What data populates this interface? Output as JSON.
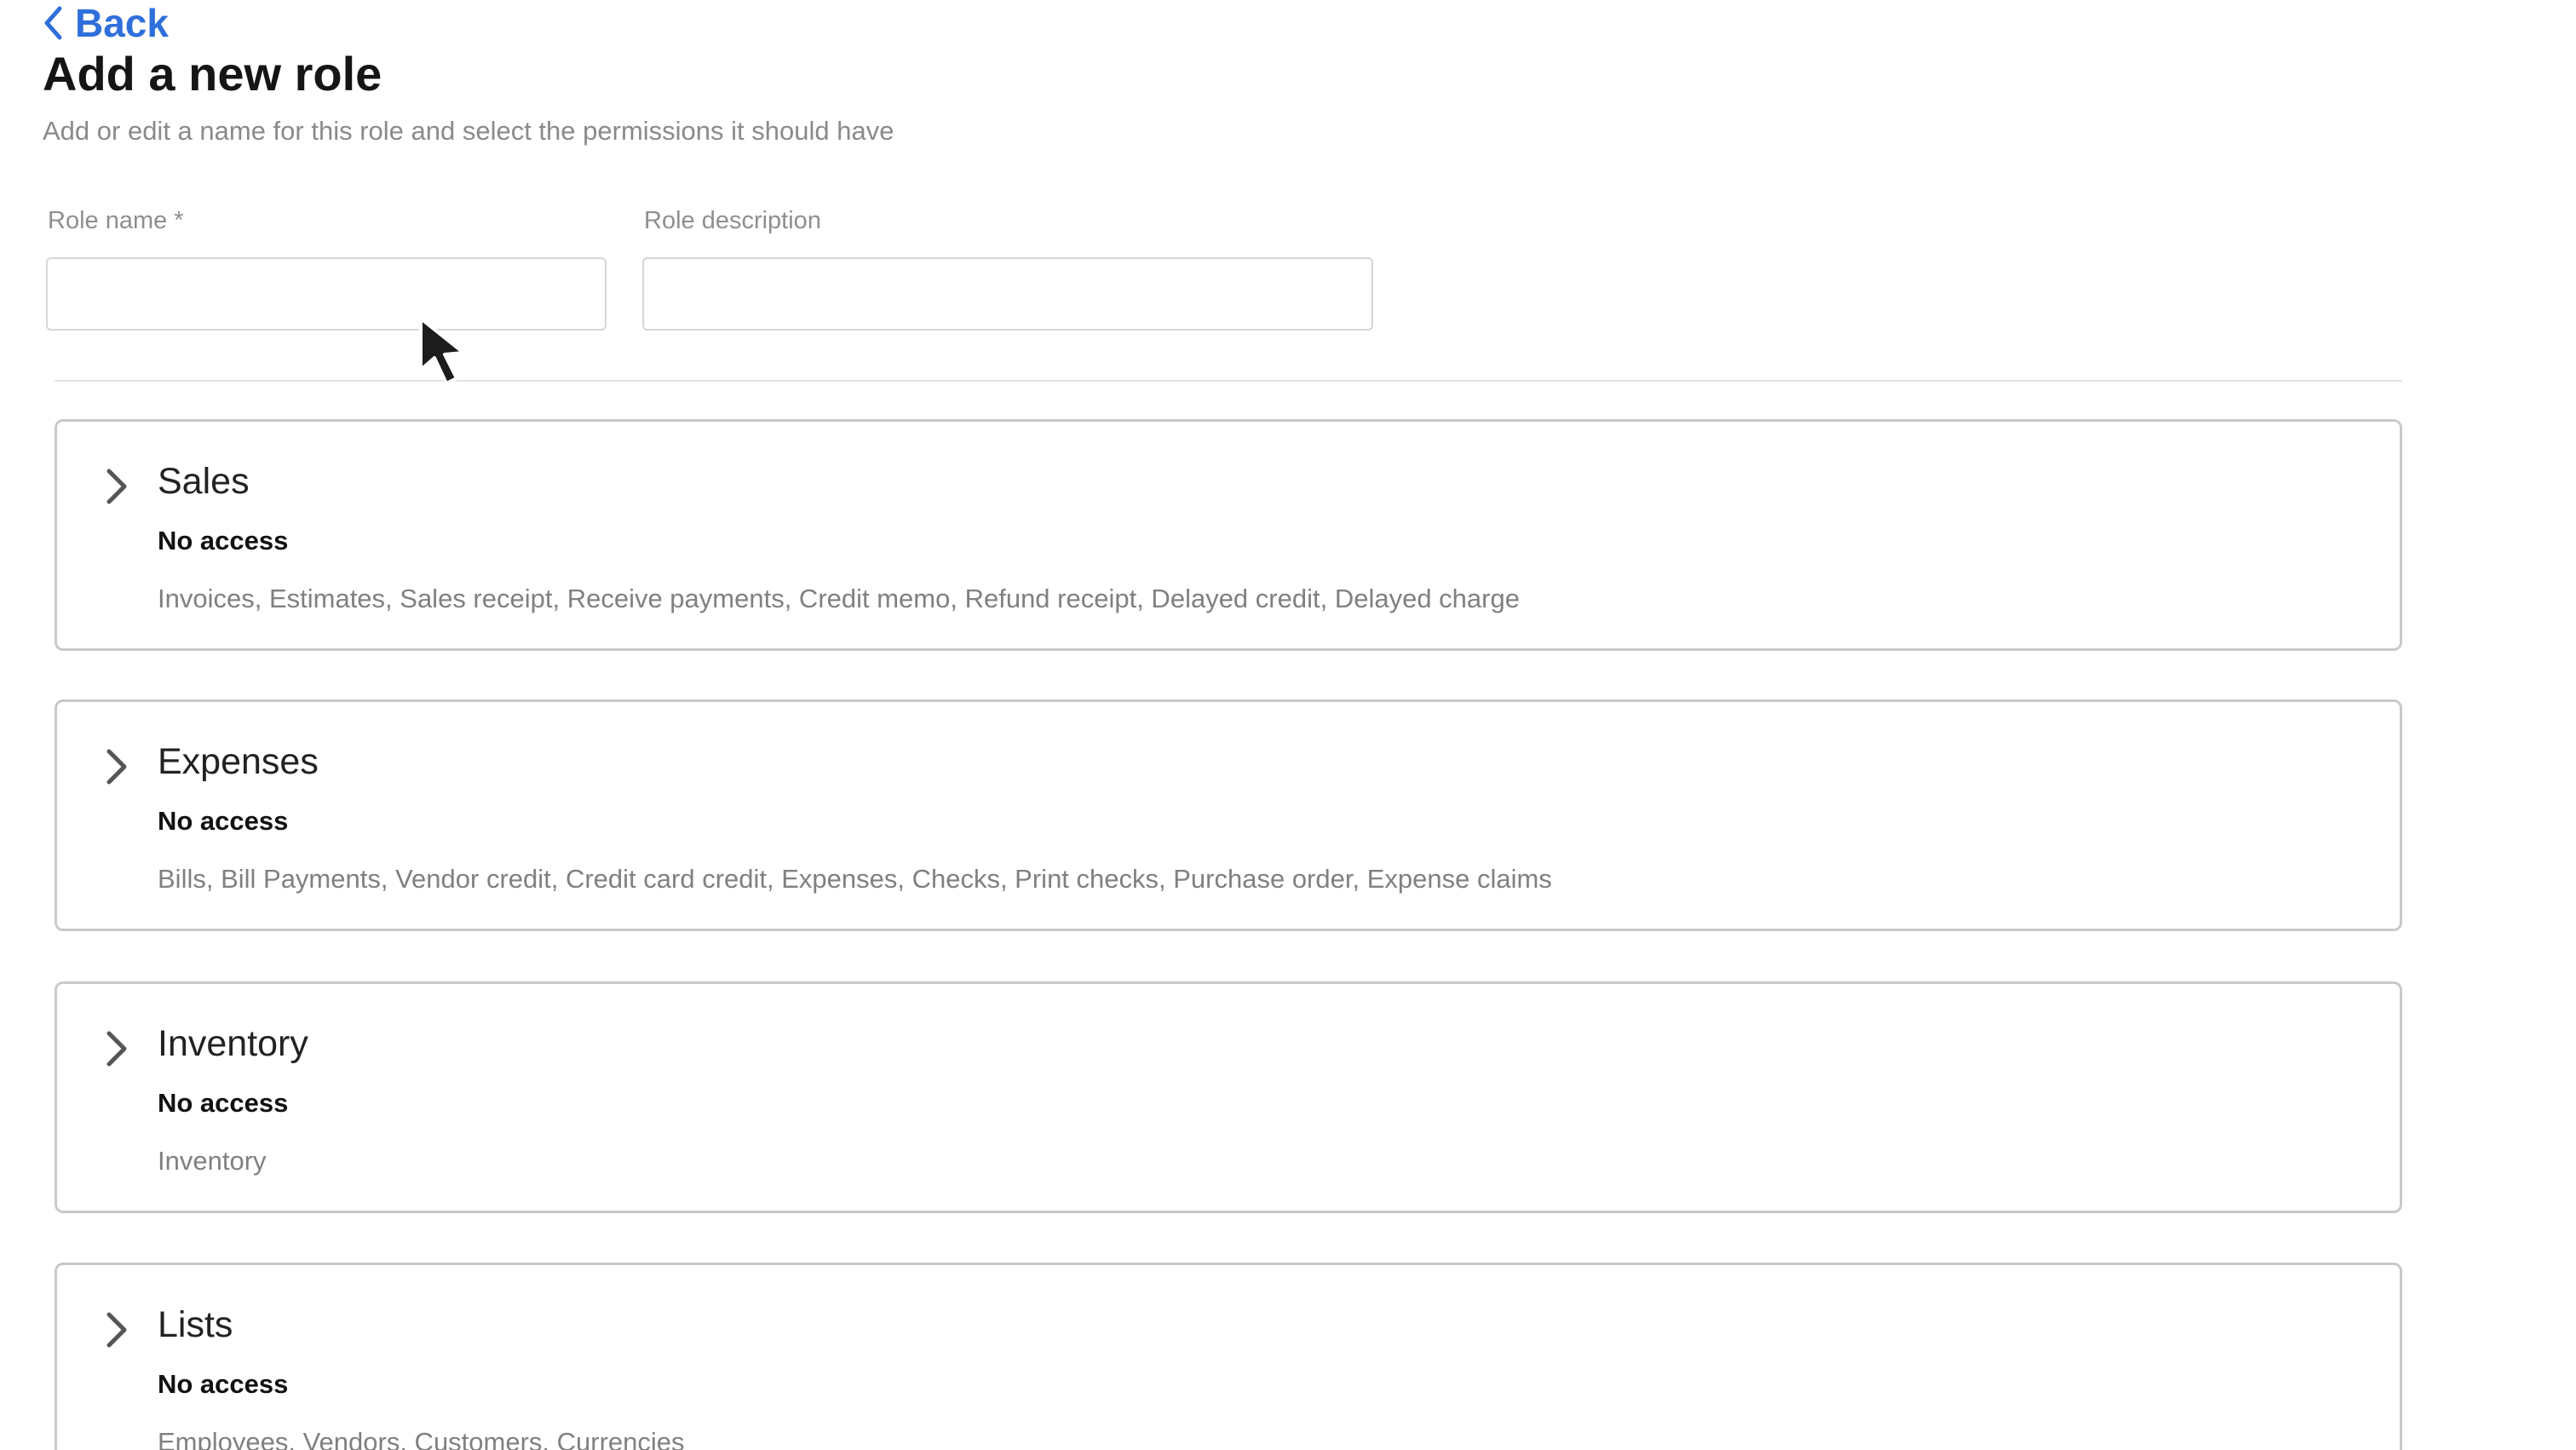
{
  "header": {
    "back_label": "Back",
    "title": "Add a new role",
    "subtitle": "Add or edit a name for this role and select the permissions it should have"
  },
  "form": {
    "role_name_label": "Role name *",
    "role_name_value": "",
    "role_description_label": "Role description",
    "role_description_value": ""
  },
  "sections": [
    {
      "title": "Sales",
      "access": "No access",
      "items": "Invoices, Estimates, Sales receipt, Receive payments, Credit memo, Refund receipt, Delayed credit, Delayed charge"
    },
    {
      "title": "Expenses",
      "access": "No access",
      "items": "Bills, Bill Payments, Vendor credit, Credit card credit, Expenses, Checks, Print checks, Purchase order, Expense claims"
    },
    {
      "title": "Inventory",
      "access": "No access",
      "items": "Inventory"
    },
    {
      "title": "Lists",
      "access": "No access",
      "items": "Employees, Vendors, Customers, Currencies"
    }
  ],
  "colors": {
    "link": "#2f6fdb",
    "panel_border": "#c9c9c9",
    "muted_text": "#808080"
  },
  "icons": {
    "back": "chevron-left-icon",
    "expand": "chevron-right-icon",
    "cursor": "mouse-pointer-icon"
  }
}
